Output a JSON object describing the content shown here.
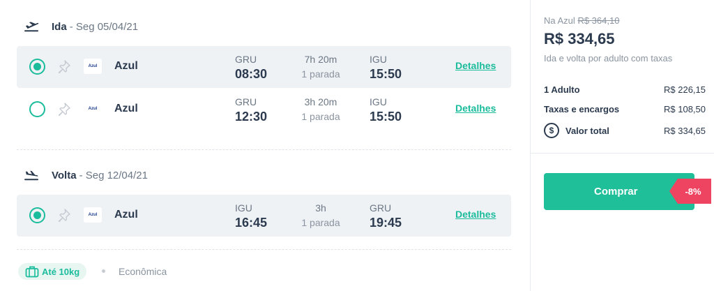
{
  "outbound": {
    "label": "Ida",
    "date": "- Seg 05/04/21",
    "icon": "plane-takeoff-icon",
    "flights": [
      {
        "selected": true,
        "airline": "Azul",
        "logo": "Azul",
        "from": "GRU",
        "dep": "08:30",
        "duration": "7h 20m",
        "stops": "1 parada",
        "to": "IGU",
        "arr": "15:50",
        "details": "Detalhes"
      },
      {
        "selected": false,
        "airline": "Azul",
        "logo": "Azul",
        "from": "GRU",
        "dep": "12:30",
        "duration": "3h 20m",
        "stops": "1 parada",
        "to": "IGU",
        "arr": "15:50",
        "details": "Detalhes"
      }
    ]
  },
  "inbound": {
    "label": "Volta",
    "date": "- Seg 12/04/21",
    "icon": "plane-landing-icon",
    "flights": [
      {
        "selected": true,
        "airline": "Azul",
        "logo": "Azul",
        "from": "IGU",
        "dep": "16:45",
        "duration": "3h",
        "stops": "1 parada",
        "to": "GRU",
        "arr": "19:45",
        "details": "Detalhes"
      }
    ]
  },
  "footer": {
    "baggage": "Até 10kg",
    "cabin": "Econômica"
  },
  "summary": {
    "original_prefix": "Na Azul",
    "original_price": "R$ 364,10",
    "price": "R$ 334,65",
    "price_note": "Ida e volta por adulto com taxas",
    "breakdown": [
      {
        "label": "1 Adulto",
        "value": "R$ 226,15"
      },
      {
        "label": "Taxas e encargos",
        "value": "R$ 108,50"
      },
      {
        "label": "Valor total",
        "value": "R$ 334,65"
      }
    ],
    "buy_label": "Comprar",
    "discount": "-8%"
  },
  "colors": {
    "accent": "#1abc9c",
    "buy": "#1fbf99",
    "discount": "#ee4462",
    "text": "#2b3a4e",
    "row_selected": "#eff2f5"
  }
}
